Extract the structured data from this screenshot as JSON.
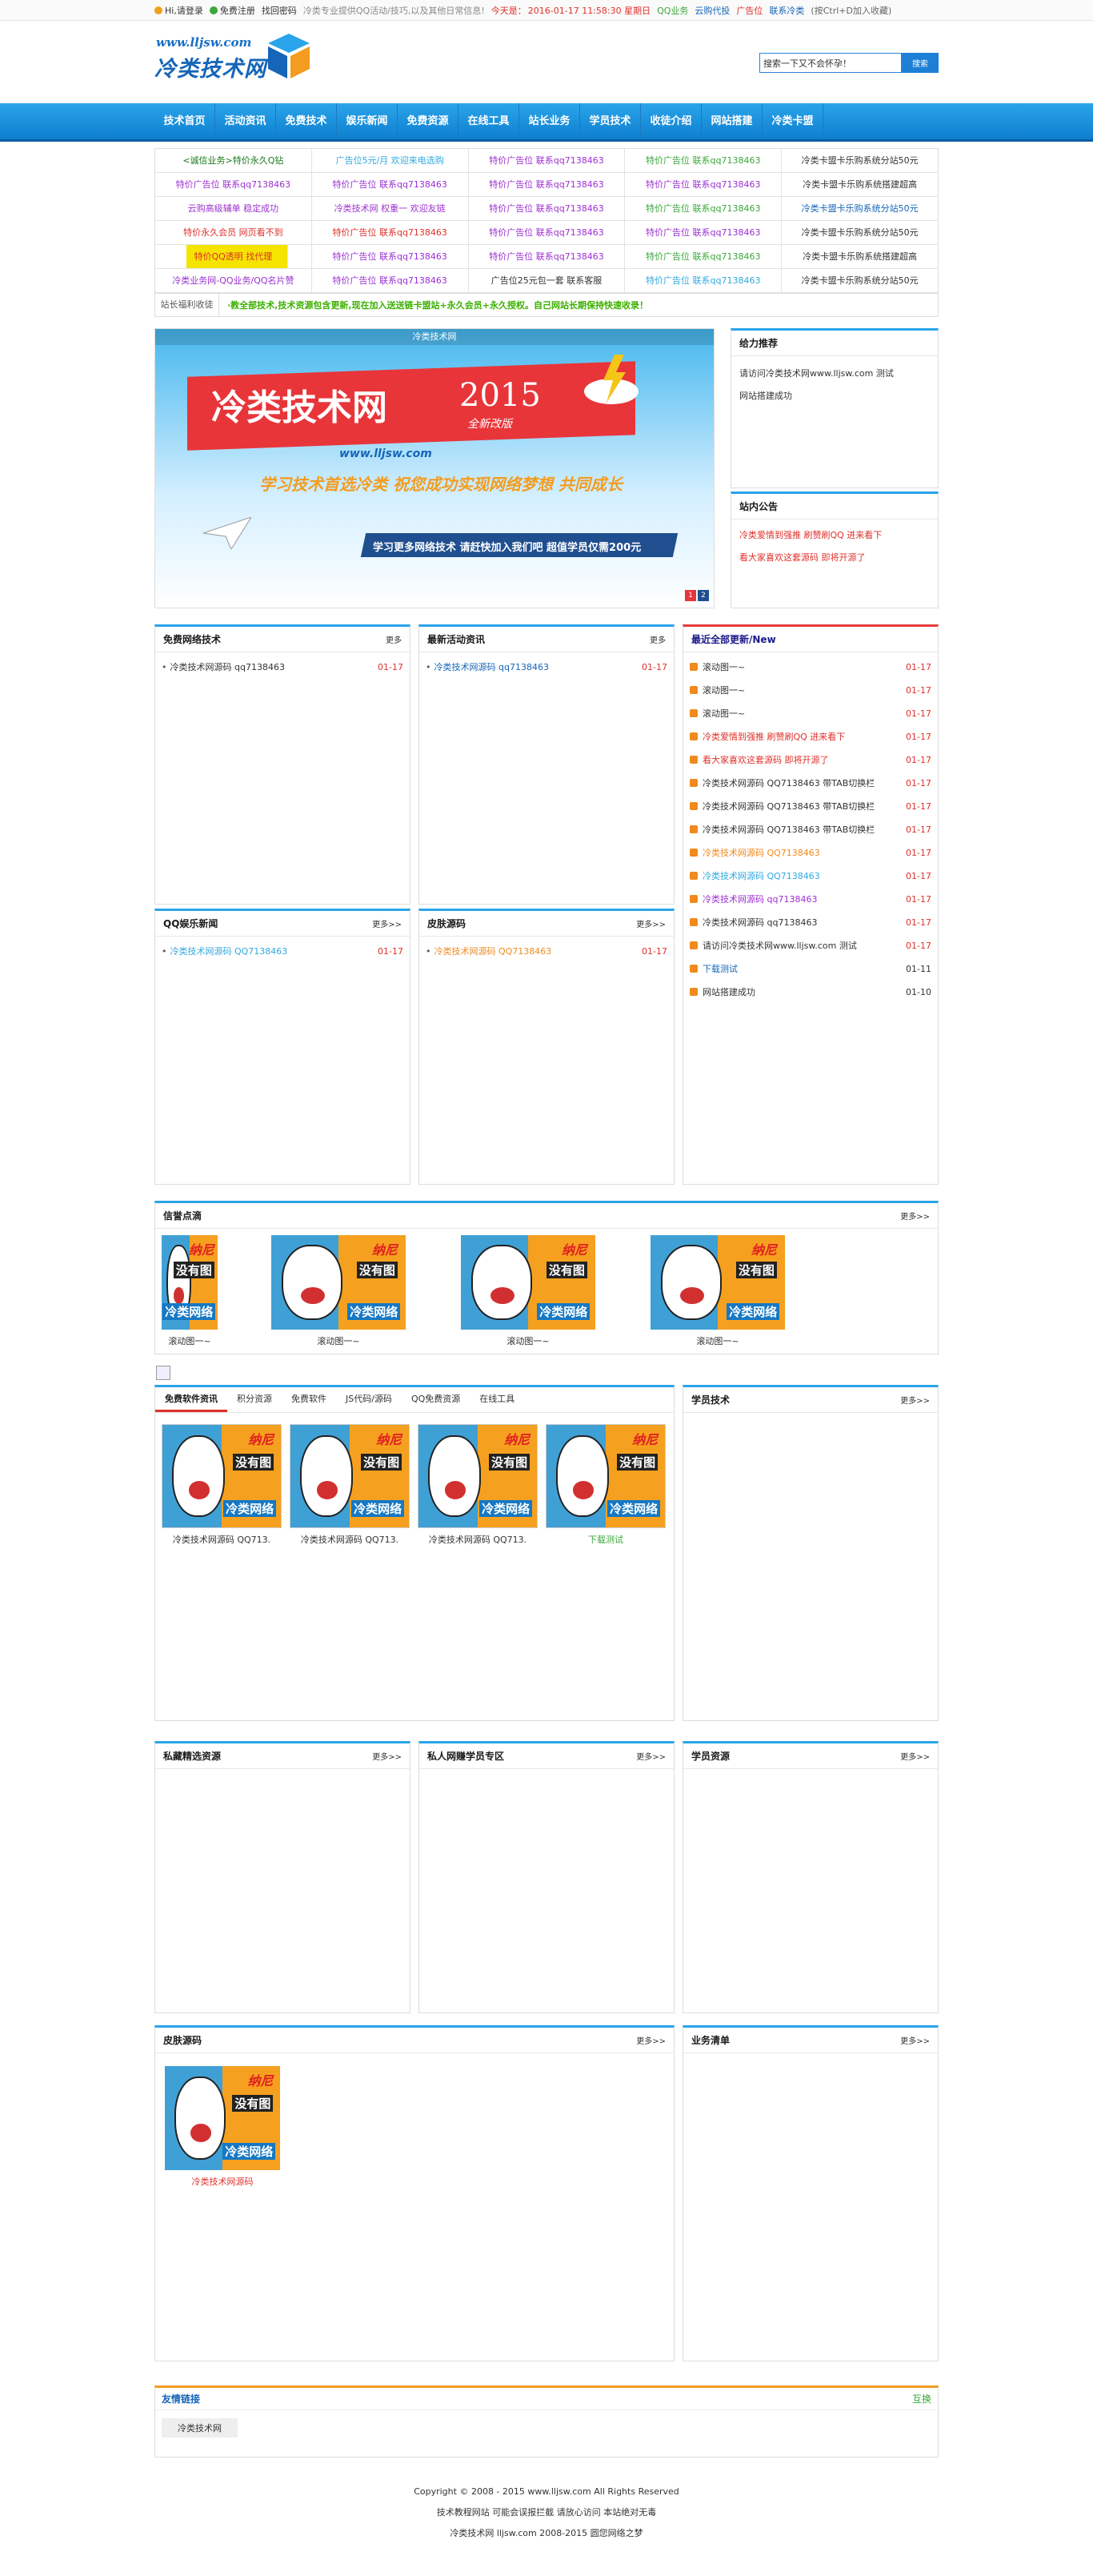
{
  "topbar": {
    "login": "Hi,请登录",
    "register": "免费注册",
    "recover": "找回密码",
    "intro": "冷类专业提供QQ活动/技巧,以及其他日常信息!",
    "today": "今天是：",
    "datetime": "2016-01-17 11:58:30 星期日",
    "links": [
      "QQ业务",
      "云购代投",
      "广告位",
      "联系冷类"
    ],
    "bookmark": "(按Ctrl+D加入收藏)"
  },
  "header": {
    "logo_url": "www.lljsw.com",
    "logo_name": "冷类技术网",
    "search_placeholder": "搜索一下又不会怀孕！",
    "search_button": "搜索"
  },
  "nav": [
    "技术首页",
    "活动资讯",
    "免费技术",
    "娱乐新闻",
    "免费资源",
    "在线工具",
    "站长业务",
    "学员技术",
    "收徒介绍",
    "网站搭建",
    "冷类卡盟"
  ],
  "adgrid": [
    [
      [
        "<诚信业务>特价永久Q钻",
        "#1b7a1b"
      ],
      [
        "广告位5元/月 欢迎来电选购",
        "#2fa9e0"
      ],
      [
        "特价广告位 联系qq7138463",
        "#9b30d0"
      ],
      [
        "特价广告位 联系qq7138463",
        "#3aa83a"
      ],
      [
        "冷类卡盟卡乐购系统分站50元",
        "#333333"
      ]
    ],
    [
      [
        "特价广告位 联系qq7138463",
        "#9b30d0"
      ],
      [
        "特价广告位 联系qq7138463",
        "#9b30d0"
      ],
      [
        "特价广告位 联系qq7138463",
        "#9b30d0"
      ],
      [
        "特价广告位 联系qq7138463",
        "#9b30d0"
      ],
      [
        "冷类卡盟卡乐购系统搭建超高",
        "#333333"
      ]
    ],
    [
      [
        "云购高级辅单 稳定成功",
        "#9b30d0"
      ],
      [
        "冷类技术网 权重一 欢迎友链",
        "#9b30d0"
      ],
      [
        "特价广告位 联系qq7138463",
        "#9b30d0"
      ],
      [
        "特价广告位 联系qq7138463",
        "#3aa83a"
      ],
      [
        "冷类卡盟卡乐购系统分站50元",
        "#1565b8"
      ]
    ],
    [
      [
        "特价永久会员 网页看不到",
        "#e0302a"
      ],
      [
        "特价广告位 联系qq7138463",
        "#e0302a"
      ],
      [
        "特价广告位 联系qq7138463",
        "#9b30d0"
      ],
      [
        "特价广告位 联系qq7138463",
        "#9b30d0"
      ],
      [
        "冷类卡盟卡乐购系统分站50元",
        "#333333"
      ]
    ],
    [
      [
        "特价QQ透明 找代理",
        "#e0302a"
      ],
      [
        "特价广告位 联系qq7138463",
        "#9b30d0"
      ],
      [
        "特价广告位 联系qq7138463",
        "#9b30d0"
      ],
      [
        "特价广告位 联系qq7138463",
        "#3aa83a"
      ],
      [
        "冷类卡盟卡乐购系统搭建超高",
        "#333333"
      ]
    ],
    [
      [
        "冷类业务网-QQ业务/QQ名片赞",
        "#9b30d0"
      ],
      [
        "特价广告位 联系qq7138463",
        "#9b30d0"
      ],
      [
        "广告位25元包一套 联系客服",
        "#333333"
      ],
      [
        "特价广告位 联系qq7138463",
        "#2fa9e0"
      ],
      [
        "冷类卡盟卡乐购系统分站50元",
        "#333333"
      ]
    ]
  ],
  "notice": {
    "label": "站长福利收徒",
    "text": "·教全部技术,技术资源包含更新,现在加入送送链卡盟站+永久会员+永久授权。自己网站长期保持快速收录！"
  },
  "banner": {
    "caption": "冷类技术网",
    "title": "冷类技术网",
    "year": "2015",
    "tagline": "全新改版",
    "site": "www.lljsw.com",
    "slogan": "学习技术首选冷类 祝您成功实现网络梦想 共同成长",
    "cta": "学习更多网络技术 请赶快加入我们吧 超值学员仅需200元",
    "pages": [
      "1",
      "2"
    ]
  },
  "side_support": {
    "title": "给力推荐",
    "items": [
      "请访问冷类技术网www.lljsw.com 测试",
      "网站搭建成功"
    ]
  },
  "side_notice": {
    "title": "站内公告",
    "items": [
      "冷类爱情到强推 刷赞刷QQ 进来看下",
      "看大家喜欢这套源码 即将开源了"
    ]
  },
  "box_free_tech": {
    "title": "免费网络技术",
    "more": "更多",
    "items": [
      [
        "冷类技术网源码 qq7138463",
        "01-17"
      ]
    ]
  },
  "box_activity": {
    "title": "最新活动资讯",
    "more": "更多",
    "items": [
      [
        "冷类技术网源码 qq7138463",
        "01-17"
      ]
    ]
  },
  "box_latest": {
    "title": "最近全部更新/New",
    "items": [
      [
        "滚动图一~",
        "01-17"
      ],
      [
        "滚动图一~",
        "01-17"
      ],
      [
        "滚动图一~",
        "01-17"
      ],
      [
        "冷类爱情到强推 刷赞刷QQ 进来看下",
        "01-17"
      ],
      [
        "看大家喜欢这套源码 即将开源了",
        "01-17"
      ],
      [
        "冷类技术网源码 QQ7138463 带TAB切换栏",
        "01-17"
      ],
      [
        "冷类技术网源码 QQ7138463 带TAB切换栏",
        "01-17"
      ],
      [
        "冷类技术网源码 QQ7138463 带TAB切换栏",
        "01-17"
      ],
      [
        "冷类技术网源码 QQ7138463",
        "01-17"
      ],
      [
        "冷类技术网源码 QQ7138463",
        "01-17"
      ],
      [
        "冷类技术网源码 qq7138463",
        "01-17"
      ],
      [
        "冷类技术网源码 qq7138463",
        "01-17"
      ],
      [
        "请访问冷类技术网www.lljsw.com 测试",
        "01-17"
      ],
      [
        "下载测试",
        "01-11"
      ],
      [
        "网站搭建成功",
        "01-10"
      ]
    ]
  },
  "box_qq": {
    "title": "QQ娱乐新闻",
    "more": "更多>>",
    "items": [
      [
        "冷类技术网源码 QQ7138463",
        "01-17"
      ]
    ]
  },
  "box_skin": {
    "title": "皮肤源码",
    "more": "更多>>",
    "items": [
      [
        "冷类技术网源码 QQ7138463",
        "01-17"
      ]
    ]
  },
  "box_credit": {
    "title": "信誉点滴",
    "more": "更多>>",
    "captions": [
      "滚动图一~",
      "滚动图一~",
      "滚动图一~",
      "滚动图一~"
    ]
  },
  "tabs": {
    "items": [
      "免费软件资讯",
      "积分资源",
      "免费软件",
      "JS代码/源码",
      "QQ免费资源",
      "在线工具"
    ],
    "captions": [
      "冷类技术网源码 QQ713.",
      "冷类技术网源码 QQ713.",
      "冷类技术网源码 QQ713.",
      "下载测试"
    ]
  },
  "box_student_tech": {
    "title": "学员技术",
    "more": "更多>>"
  },
  "box_private": {
    "title": "私藏精选资源",
    "more": "更多>>"
  },
  "box_personal": {
    "title": "私人网赚学员专区",
    "more": "更多>>"
  },
  "box_student_res": {
    "title": "学员资源",
    "more": "更多>>"
  },
  "box_skin2": {
    "title": "皮肤源码",
    "more": "更多>>",
    "caption": "冷类技术网源码"
  },
  "box_business": {
    "title": "业务清单",
    "more": "更多>>"
  },
  "meme": {
    "t1": "纳尼",
    "t2": "没有图",
    "t3": "冷类网络"
  },
  "friends": {
    "title": "友情链接",
    "apply": "互换",
    "items": [
      "冷类技术网"
    ]
  },
  "footer": [
    "Copyright © 2008 - 2015 www.lljsw.com All Rights Reserved",
    "技术教程网站 可能会误报拦截 请放心访问 本站绝对无毒",
    "冷类技术网 lljsw.com 2008-2015 圆您网络之梦"
  ]
}
